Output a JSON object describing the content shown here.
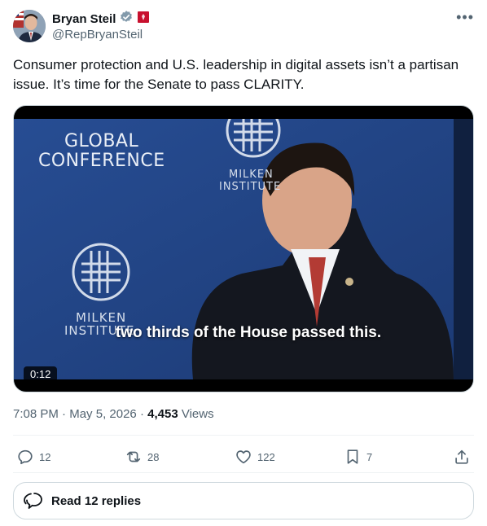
{
  "author": {
    "name": "Bryan Steil",
    "handle": "@RepBryanSteil",
    "verified": true,
    "badge_color": "#829aab",
    "flag_color": "#c8102e"
  },
  "tweet": {
    "text": "Consumer protection and U.S. leadership in digital assets isn’t a partisan issue. It’s time for the Senate to pass CLARITY."
  },
  "media": {
    "duration": "0:12",
    "subtitle": "two thirds of the House passed this.",
    "backdrop": {
      "banner_line1": "GLOBAL",
      "banner_line2": "CONFERENCE",
      "logo_text_top_line1": "MILKEN",
      "logo_text_top_line2": "INSTITUTE",
      "logo_text_bottom_line1": "MILKEN",
      "logo_text_bottom_line2": "INSTITUTE"
    }
  },
  "meta": {
    "time": "7:08 PM",
    "date": "May 5, 2026",
    "views_count": "4,453",
    "views_label": "Views"
  },
  "actions": {
    "replies": "12",
    "reposts": "28",
    "likes": "122",
    "bookmarks": "7"
  },
  "read_replies_label": "Read 12 replies",
  "colors": {
    "text_primary": "#0f1419",
    "text_secondary": "#536471",
    "border": "#cfd9de",
    "backdrop_blue": "#22458a"
  }
}
